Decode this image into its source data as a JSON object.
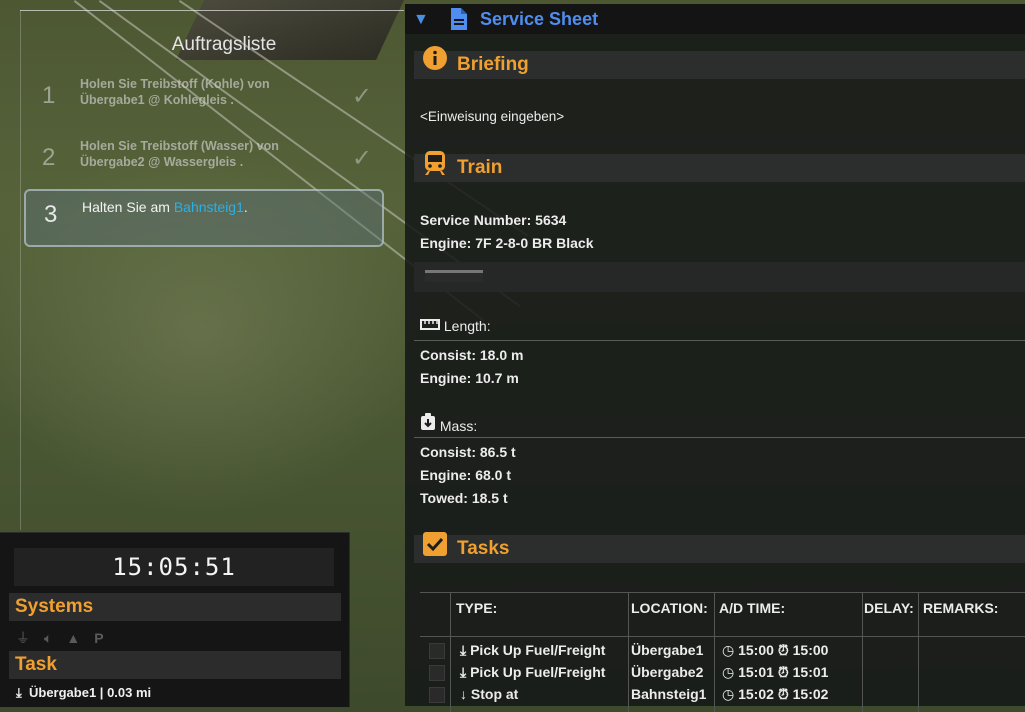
{
  "auftragsliste": {
    "title": "Auftragsliste",
    "jobs": [
      {
        "num": "1",
        "line1": "Holen Sie Treibstoff (Kohle)  von",
        "line2": "Übergabe1 @ Kohlegleis .",
        "done": true
      },
      {
        "num": "2",
        "line1": "Holen Sie Treibstoff (Wasser)  von",
        "line2": "Übergabe2 @ Wassergleis .",
        "done": true
      },
      {
        "num": "3",
        "text_before": "Halten Sie am ",
        "highlight": "Bahnsteig1",
        "text_after": ".",
        "active": true
      }
    ]
  },
  "hud": {
    "clock": "15:05:51",
    "systems_label": "Systems",
    "parking_label": "P",
    "task_label": "Task",
    "task_location": "Übergabe1",
    "task_distance": "0.03 mi"
  },
  "sheet": {
    "title": "Service Sheet",
    "briefing": {
      "heading": "Briefing",
      "text": "<Einweisung eingeben>"
    },
    "train": {
      "heading": "Train",
      "service_number": "Service Number: 5634",
      "engine": "Engine: 7F 2-8-0 BR Black"
    },
    "length": {
      "heading": "Length:",
      "consist": "Consist: 18.0 m",
      "engine": "Engine: 10.7 m"
    },
    "mass": {
      "heading": "Mass:",
      "consist": "Consist: 86.5 t",
      "engine": "Engine: 68.0 t",
      "towed": "Towed: 18.5 t"
    },
    "tasks": {
      "heading": "Tasks",
      "columns": [
        "TYPE:",
        "LOCATION:",
        "A/D TIME:",
        "DELAY:",
        "REMARKS:"
      ],
      "rows": [
        {
          "type": "Pick Up Fuel/Freight",
          "location": "Übergabe1",
          "arrive": "15:00",
          "depart": "15:00"
        },
        {
          "type": "Pick Up Fuel/Freight",
          "location": "Übergabe2",
          "arrive": "15:01",
          "depart": "15:01"
        },
        {
          "type": "Stop at",
          "location": "Bahnsteig1",
          "arrive": "15:02",
          "depart": "15:02"
        }
      ]
    }
  },
  "colors": {
    "accent": "#f0a030",
    "title_blue": "#4f8ef0",
    "highlight": "#2ab0e8"
  }
}
